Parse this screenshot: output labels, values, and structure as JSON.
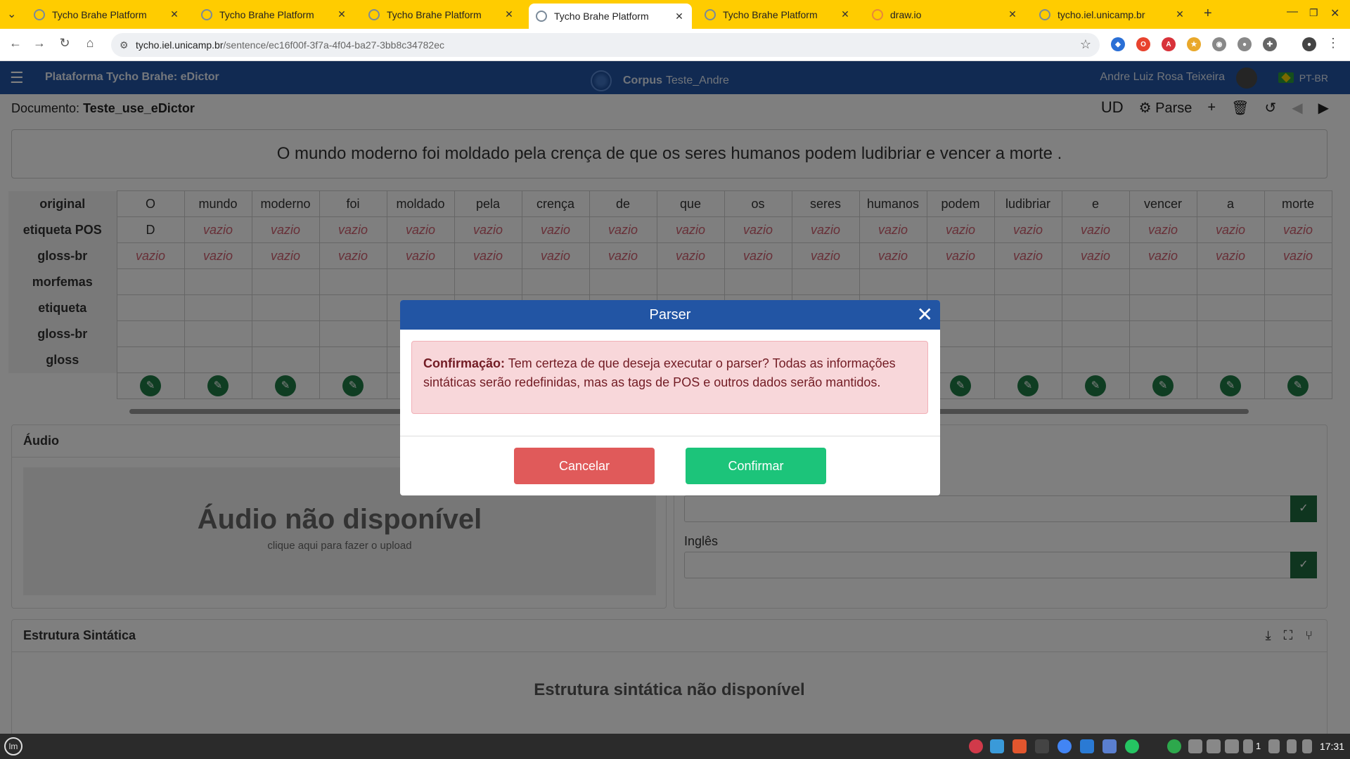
{
  "browser": {
    "tabs": [
      {
        "label": "Tycho Brahe Platform"
      },
      {
        "label": "Tycho Brahe Platform"
      },
      {
        "label": "Tycho Brahe Platform"
      },
      {
        "label": "Tycho Brahe Platform"
      },
      {
        "label": "Tycho Brahe Platform"
      },
      {
        "label": "draw.io"
      },
      {
        "label": "tycho.iel.unicamp.br"
      }
    ],
    "url_host": "tycho.iel.unicamp.br",
    "url_path": "/sentence/ec16f00f-3f7a-4f04-ba27-3bb8c34782ec"
  },
  "app": {
    "brand": "Plataforma Tycho Brahe: eDictor",
    "corpus_label": "Corpus",
    "corpus_name": "Teste_Andre",
    "user": "Andre Luiz Rosa Teixeira",
    "lang": "PT-BR"
  },
  "document": {
    "label": "Documento:",
    "name": "Teste_use_eDictor",
    "ud_label": "UD",
    "parse_label": "Parse"
  },
  "sentence": "O mundo moderno foi moldado pela crença de que os seres humanos podem ludibriar e vencer a morte .",
  "grid": {
    "row_labels": [
      "original",
      "etiqueta POS",
      "gloss-br",
      "morfemas",
      "etiqueta",
      "gloss-br",
      "gloss"
    ],
    "tokens": [
      "O",
      "mundo",
      "moderno",
      "foi",
      "moldado",
      "pela",
      "crença",
      "de",
      "que",
      "os",
      "seres",
      "humanos",
      "podem",
      "ludibriar",
      "e",
      "vencer",
      "a",
      "morte"
    ],
    "pos": [
      "D",
      "vazio",
      "vazio",
      "vazio",
      "vazio",
      "vazio",
      "vazio",
      "vazio",
      "vazio",
      "vazio",
      "vazio",
      "vazio",
      "vazio",
      "vazio",
      "vazio",
      "vazio",
      "vazio",
      "vazio"
    ],
    "gloss_br": [
      "vazio",
      "vazio",
      "vazio",
      "vazio",
      "vazio",
      "vazio",
      "vazio",
      "vazio",
      "vazio",
      "vazio",
      "vazio",
      "vazio",
      "vazio",
      "vazio",
      "vazio",
      "vazio",
      "vazio",
      "vazio"
    ]
  },
  "audio": {
    "title": "Áudio",
    "unavailable": "Áudio não disponível",
    "upload_hint": "clique aqui para fazer o upload"
  },
  "translation": {
    "english_label": "Inglês"
  },
  "syntax": {
    "title": "Estrutura Sintática",
    "unavailable": "Estrutura sintática não disponível"
  },
  "modal": {
    "title": "Parser",
    "alert_strong": "Confirmação:",
    "alert_text": "Tem certeza de que deseja executar o parser? Todas as informações sintáticas serão redefinidas, mas as tags de POS e outros dados serão mantidos.",
    "cancel": "Cancelar",
    "confirm": "Confirmar"
  },
  "taskbar": {
    "clock": "17:31",
    "tray_count": "1"
  }
}
